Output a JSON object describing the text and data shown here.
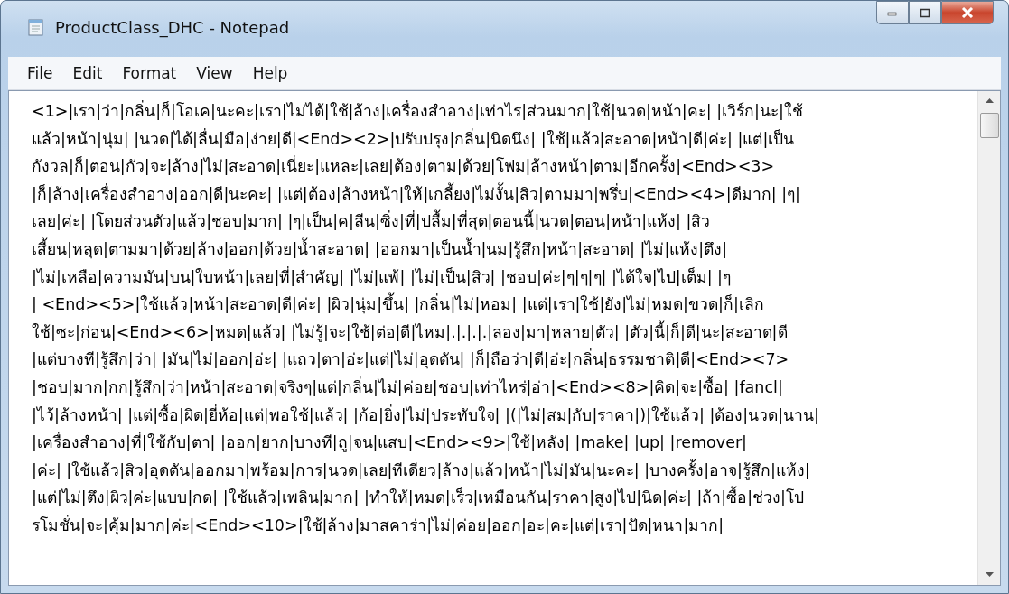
{
  "window": {
    "title": "ProductClass_DHC - Notepad"
  },
  "menu": [
    "File",
    "Edit",
    "Format",
    "View",
    "Help"
  ],
  "lines": [
    "<1>|เรา|ว่า|กลิ่น|ก็|โอเค|นะคะ|เรา|ไม่ได้|ใช้|ล้าง|เครื่องสำอาง|เท่าไร|ส่วนมาก|ใช้|นวด|หน้า|คะ| |เวิร์ก|นะ|ใช้",
    "แล้ว|หน้า|นุ่ม| |นวด|ได้|ลื่น|มือ|ง่าย|ดี|<End><2>|ปรับปรุง|กลิ่น|นิดนึง| |ใช้|แล้ว|สะอาด|หน้า|ดี|ค่ะ| |แต่|เป็น",
    "กังวล|ก็|ตอน|กัว|จะ|ล้าง|ไม่|สะอาด|เนี่ยะ|แหละ|เลย|ต้อง|ตาม|ด้วย|โฟม|ล้างหน้า|ตาม|อีกครั้ง|<End><3>",
    "|ก็|ล้าง|เครื่องสำอาง|ออก|ดี|นะคะ| |แต่|ต้อง|ล้างหน้า|ให้|เกลี้ยง|ไม่งั้น|สิว|ตามมา|พรึ่บ|<End><4>|ดีมาก| |ๆ|",
    "เลย|ค่ะ| |โดยส่วนตัว|แล้ว|ชอบ|มาก| |ๆ|เป็น|ค|ลีน|ซิ่ง|ที่|ปลื้ม|ที่สุด|ตอนนี้|นวด|ตอน|หน้า|แห้ง| |สิว",
    "เสี้ยน|หลุด|ตามมา|ด้วย|ล้าง|ออก|ด้วย|น้ำสะอาด| |ออกมา|เป็นน้ำ|นม|รู้สึก|หน้า|สะอาด| |ไม่|แห้ง|ตึง|",
    "|ไม่|เหลือ|ความมัน|บน|ใบหน้า|เลย|ที่|สำคัญ| |ไม่|แพ้| |ไม่|เป็น|สิว| |ชอบ|ค่ะ|ๆ|ๆ|ๆ| |ได้ใจ|ไป|เต็ม| |ๆ",
    "| <End><5>|ใช้แล้ว|หน้า|สะอาด|ดี|ค่ะ| |ผิว|นุ่ม|ขึ้น| |กลิ่น|ไม่|หอม| |แต่|เรา|ใช้|ยัง|ไม่|หมด|ขวด|ก็|เลิก",
    "ใช้|ซะ|ก่อน|<End><6>|หมด|แล้ว| |ไม่รู้|จะ|ใช้|ต่อ|ดี|ไหม|.|.|.|.|ลอง|มา|หลาย|ตัว| |ตัว|นี้|ก็|ดี|นะ|สะอาด|ดี",
    "|แต่บางที|รู้สึก|ว่า| |มัน|ไม่|ออก|อ่ะ| |แถว|ตา|อ่ะ|แต่|ไม่|อุดตัน| |ก็|ถือว่า|ดี|อ่ะ|กลิ่น|ธรรมชาติ|ดี|<End><7>",
    "|ชอบ|มาก|กก|รู้สึก|ว่า|หน้า|สะอาด|จริงๆ|แต่|กลิ่น|ไม่|ค่อย|ชอบ|เท่าไหร่|อ่า|<End><8>|คิด|จะ|ซื้อ| |fancl|",
    "|ไว้|ล้างหน้า| |แต่|ซื้อ|ผิด|ยี่ห้อ|แต่|พอใช้|แล้ว| |ก้อ|ยิ่ง|ไม่|ประทับใจ| |(|ไม่|สม|กับ|ราคา|)|ใช้แล้ว| |ต้อง|นวด|นาน|",
    "|เครื่องสำอาง|ที่|ใช้กับ|ตา| |ออก|ยาก|บางที|ถู|จน|แสบ|<End><9>|ใช้|หลัง| |make| |up| |remover|",
    "|ค่ะ| |ใช้แล้ว|สิว|อุดตัน|ออกมา|พร้อม|การ|นวด|เลย|ทีเดียว|ล้าง|แล้ว|หน้า|ไม่|มัน|นะคะ| |บางครั้ง|อาจ|รู้สึก|แห้ง|",
    "|แต่|ไม่|ตึง|ผิว|ค่ะ|แบบ|กด| |ใช้แล้ว|เพลิน|มาก| |ทำให้|หมด|เร็ว|เหมือนกัน|ราคา|สูง|ไป|นิด|ค่ะ| |ถ้า|ซื้อ|ช่วง|โป",
    "รโมชั่น|จะ|คุ้ม|มาก|ค่ะ|<End><10>|ใช้|ล้าง|มาสคาร่า|ไม่|ค่อย|ออก|อะ|คะ|แต่|เรา|ปัด|หนา|มาก|"
  ]
}
